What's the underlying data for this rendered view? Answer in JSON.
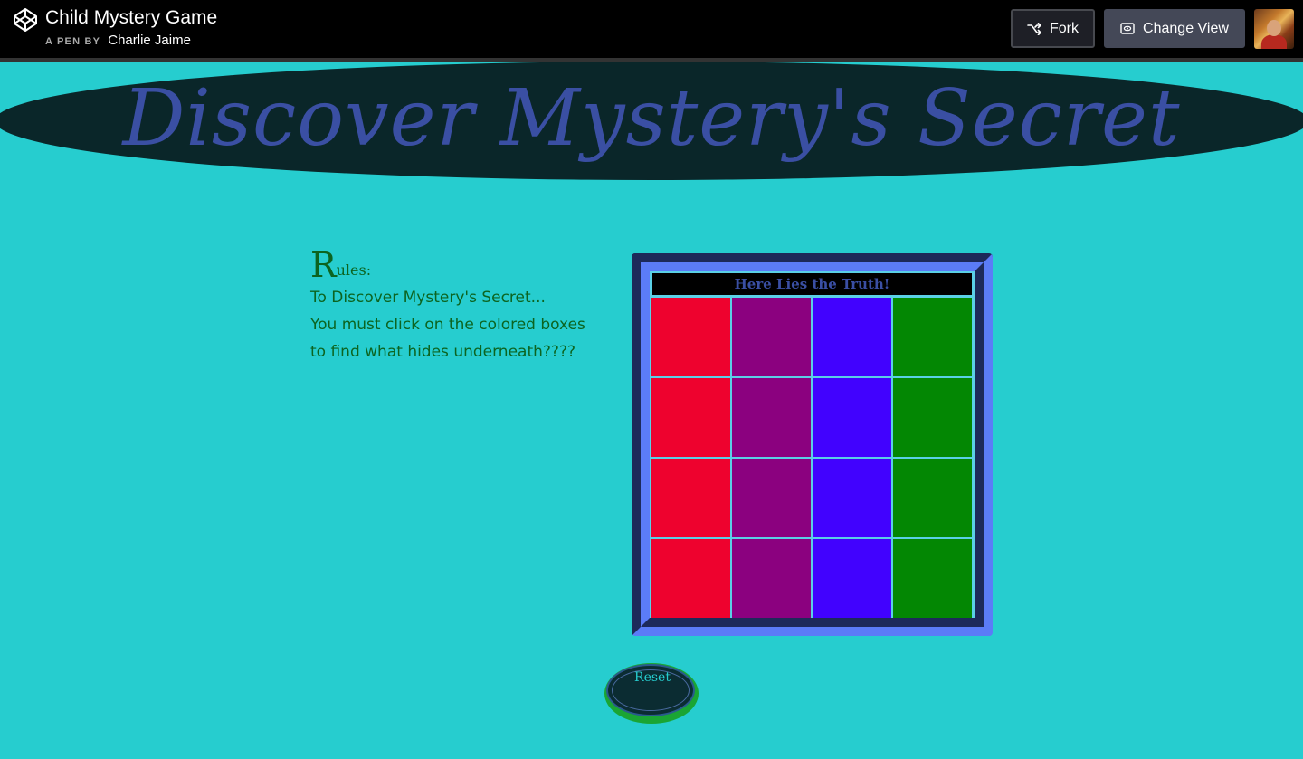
{
  "pen": {
    "title": "Child Mystery Game",
    "by_prefix": "A PEN BY",
    "author": "Charlie Jaime"
  },
  "toolbar": {
    "fork_label": "Fork",
    "change_view_label": "Change View"
  },
  "banner": {
    "title": "Discover Mystery's Secret"
  },
  "rules": {
    "heading_initial": "R",
    "heading_rest": "ules:",
    "lines": [
      "To Discover Mystery's Secret...",
      "You must click on the colored boxes",
      "to find what hides underneath????"
    ]
  },
  "board": {
    "caption": "Here Lies the Truth!",
    "column_colors": [
      "#ee022e",
      "#8b017f",
      "#4102fe",
      "#038703"
    ],
    "rows": 4
  },
  "reset": {
    "label": "Reset"
  },
  "colors": {
    "page_background": "#26cdcf",
    "banner_background": "#0a2629",
    "title_text": "#3a4fa3",
    "rules_text": "#0c6420",
    "board_frame_light": "#5b7cf7",
    "board_frame_dark": "#1d2a5a",
    "reset_base": "#1aa534"
  },
  "icons": {
    "logo": "codepen-logo-icon",
    "fork": "fork-icon",
    "change_view": "eye-window-icon"
  }
}
